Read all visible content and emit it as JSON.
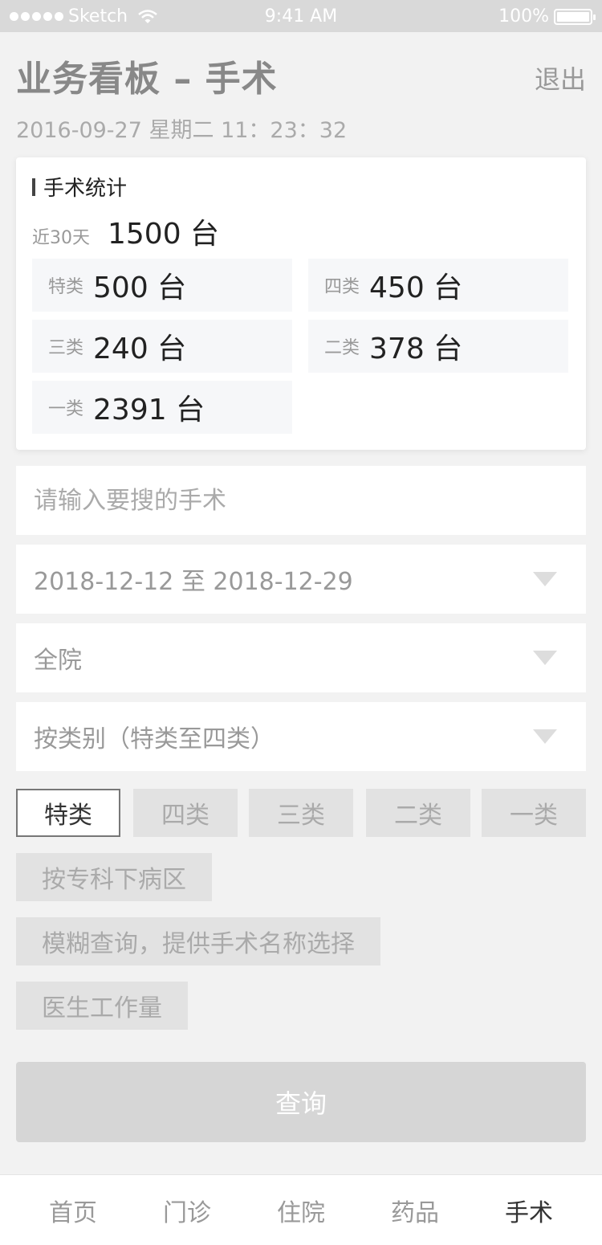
{
  "status_bar": {
    "carrier": "Sketch",
    "time": "9:41 AM",
    "battery": "100%"
  },
  "header": {
    "title": "业务看板 – 手术",
    "logout_label": "退出",
    "datetime": "2016-09-27   星期二   11：23：32"
  },
  "stats": {
    "title": "手术统计",
    "summary_label": "近30天",
    "summary_value": "1500 台",
    "categories": [
      {
        "label": "特类",
        "value": "500 台"
      },
      {
        "label": "四类",
        "value": "450 台"
      },
      {
        "label": "三类",
        "value": "240 台"
      },
      {
        "label": "二类",
        "value": "378 台"
      },
      {
        "label": "一类",
        "value": "2391 台"
      }
    ]
  },
  "form": {
    "search_placeholder": "请输入要搜的手术",
    "date_range": "2018-12-12  至  2018-12-29",
    "scope": "全院",
    "group_by": "按类别（特类至四类）"
  },
  "chips": [
    {
      "label": "特类",
      "active": true
    },
    {
      "label": "四类"
    },
    {
      "label": "三类"
    },
    {
      "label": "二类"
    },
    {
      "label": "一类"
    }
  ],
  "options": [
    {
      "label": "按专科下病区"
    },
    {
      "label": "模糊查询，提供手术名称选择"
    },
    {
      "label": "医生工作量"
    }
  ],
  "query_label": "查询",
  "tabs": [
    {
      "label": "首页"
    },
    {
      "label": "门诊"
    },
    {
      "label": "住院"
    },
    {
      "label": "药品"
    },
    {
      "label": "手术",
      "active": true
    }
  ],
  "colors": {
    "background": "#f2f2f2",
    "status_bar": "#d9d9d9",
    "chip_inactive": "#e2e2e2",
    "query_button": "#d6d6d6"
  }
}
